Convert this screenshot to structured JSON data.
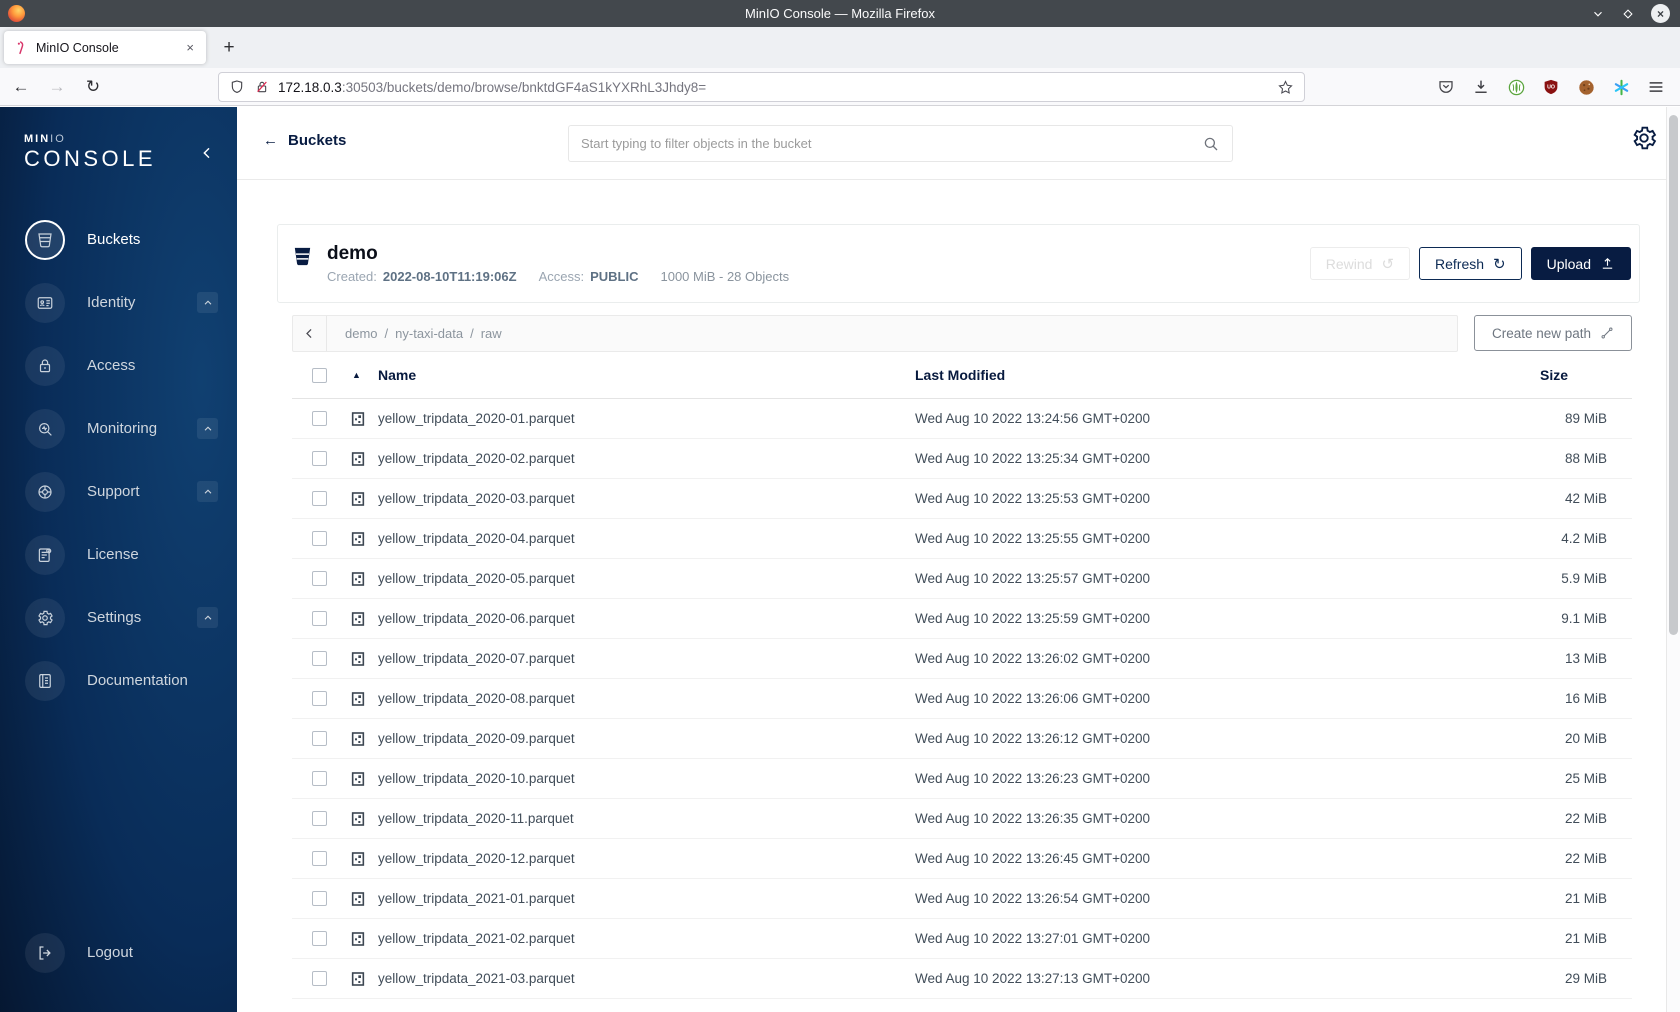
{
  "window": {
    "title": "MinIO Console — Mozilla Firefox"
  },
  "browser": {
    "tab_title": "MinIO Console",
    "new_tab_label": "+",
    "url_host": "172.18.0.3",
    "url_rest": ":30503/buckets/demo/browse/bnktdGF4aS1kYXRhL3Jhdy8="
  },
  "sidebar": {
    "logo_primary": "MIN",
    "logo_primary_light": "IO",
    "logo_secondary": "CONSOLE",
    "items": [
      {
        "label": "Buckets",
        "icon": "bucket-icon",
        "active": true,
        "expandable": false
      },
      {
        "label": "Identity",
        "icon": "identity-icon",
        "active": false,
        "expandable": true
      },
      {
        "label": "Access",
        "icon": "lock-icon",
        "active": false,
        "expandable": false
      },
      {
        "label": "Monitoring",
        "icon": "monitoring-icon",
        "active": false,
        "expandable": true
      },
      {
        "label": "Support",
        "icon": "support-icon",
        "active": false,
        "expandable": true
      },
      {
        "label": "License",
        "icon": "license-icon",
        "active": false,
        "expandable": false
      },
      {
        "label": "Settings",
        "icon": "gear-icon",
        "active": false,
        "expandable": true
      },
      {
        "label": "Documentation",
        "icon": "docs-icon",
        "active": false,
        "expandable": false
      }
    ],
    "logout_label": "Logout"
  },
  "header": {
    "back_label": "Buckets",
    "search_placeholder": "Start typing to filter objects in the bucket"
  },
  "bucket": {
    "name": "demo",
    "created_label": "Created:",
    "created_value": "2022-08-10T11:19:06Z",
    "access_label": "Access:",
    "access_value": "PUBLIC",
    "usage": "1000 MiB - 28 Objects",
    "actions": {
      "rewind": "Rewind",
      "refresh": "Refresh",
      "upload": "Upload"
    }
  },
  "browse": {
    "breadcrumb": [
      "demo",
      "ny-taxi-data",
      "raw"
    ],
    "breadcrumb_separator": "/",
    "create_path_label": "Create new path"
  },
  "table": {
    "headers": {
      "name": "Name",
      "modified": "Last Modified",
      "size": "Size"
    },
    "rows": [
      {
        "name": "yellow_tripdata_2020-01.parquet",
        "modified": "Wed Aug 10 2022 13:24:56 GMT+0200",
        "size": "89 MiB"
      },
      {
        "name": "yellow_tripdata_2020-02.parquet",
        "modified": "Wed Aug 10 2022 13:25:34 GMT+0200",
        "size": "88 MiB"
      },
      {
        "name": "yellow_tripdata_2020-03.parquet",
        "modified": "Wed Aug 10 2022 13:25:53 GMT+0200",
        "size": "42 MiB"
      },
      {
        "name": "yellow_tripdata_2020-04.parquet",
        "modified": "Wed Aug 10 2022 13:25:55 GMT+0200",
        "size": "4.2 MiB"
      },
      {
        "name": "yellow_tripdata_2020-05.parquet",
        "modified": "Wed Aug 10 2022 13:25:57 GMT+0200",
        "size": "5.9 MiB"
      },
      {
        "name": "yellow_tripdata_2020-06.parquet",
        "modified": "Wed Aug 10 2022 13:25:59 GMT+0200",
        "size": "9.1 MiB"
      },
      {
        "name": "yellow_tripdata_2020-07.parquet",
        "modified": "Wed Aug 10 2022 13:26:02 GMT+0200",
        "size": "13 MiB"
      },
      {
        "name": "yellow_tripdata_2020-08.parquet",
        "modified": "Wed Aug 10 2022 13:26:06 GMT+0200",
        "size": "16 MiB"
      },
      {
        "name": "yellow_tripdata_2020-09.parquet",
        "modified": "Wed Aug 10 2022 13:26:12 GMT+0200",
        "size": "20 MiB"
      },
      {
        "name": "yellow_tripdata_2020-10.parquet",
        "modified": "Wed Aug 10 2022 13:26:23 GMT+0200",
        "size": "25 MiB"
      },
      {
        "name": "yellow_tripdata_2020-11.parquet",
        "modified": "Wed Aug 10 2022 13:26:35 GMT+0200",
        "size": "22 MiB"
      },
      {
        "name": "yellow_tripdata_2020-12.parquet",
        "modified": "Wed Aug 10 2022 13:26:45 GMT+0200",
        "size": "22 MiB"
      },
      {
        "name": "yellow_tripdata_2021-01.parquet",
        "modified": "Wed Aug 10 2022 13:26:54 GMT+0200",
        "size": "21 MiB"
      },
      {
        "name": "yellow_tripdata_2021-02.parquet",
        "modified": "Wed Aug 10 2022 13:27:01 GMT+0200",
        "size": "21 MiB"
      },
      {
        "name": "yellow_tripdata_2021-03.parquet",
        "modified": "Wed Aug 10 2022 13:27:13 GMT+0200",
        "size": "29 MiB"
      }
    ]
  },
  "colors": {
    "accent": "#081c42",
    "sidebar_dark": "#041024",
    "sidebar_light": "#104071"
  }
}
